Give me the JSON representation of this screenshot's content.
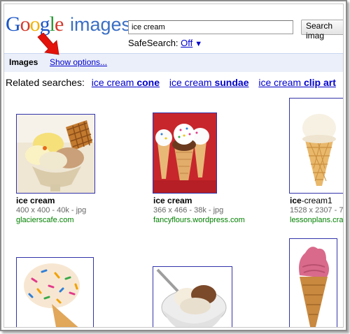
{
  "header": {
    "logo_google": [
      "G",
      "o",
      "o",
      "g",
      "l",
      "e"
    ],
    "logo_images": "images",
    "search_value": "ice cream",
    "search_button": "Search imag",
    "safesearch_label": "SafeSearch:",
    "safesearch_value": "Off",
    "safesearch_caret": "▼"
  },
  "bar": {
    "title": "Images",
    "show_options": "Show options..."
  },
  "related": {
    "label": "Related searches:",
    "items": [
      {
        "prefix": "ice cream ",
        "bold": "cone"
      },
      {
        "prefix": "ice cream ",
        "bold": "sundae"
      },
      {
        "prefix": "ice cream ",
        "bold": "clip art"
      }
    ]
  },
  "results": [
    {
      "title": "ice cream",
      "meta": "400 x 400 - 40k - jpg",
      "site": "glacierscafe.com"
    },
    {
      "title": "ice cream",
      "meta": "366 x 466 - 38k - jpg",
      "site": "fancyflours.wordpress.com"
    },
    {
      "title_bold": "ice",
      "title_rest": "-cream1",
      "meta": "1528 x 2307 - 7",
      "site": "lessonplans.cra"
    }
  ],
  "colors": {
    "g_blue": "#1a56c6",
    "g_red": "#d43a2c",
    "g_yellow": "#f2b300",
    "g_green": "#2d9a3b",
    "link": "#0000cc",
    "url_green": "#008000",
    "arrow": "#e3120b"
  }
}
